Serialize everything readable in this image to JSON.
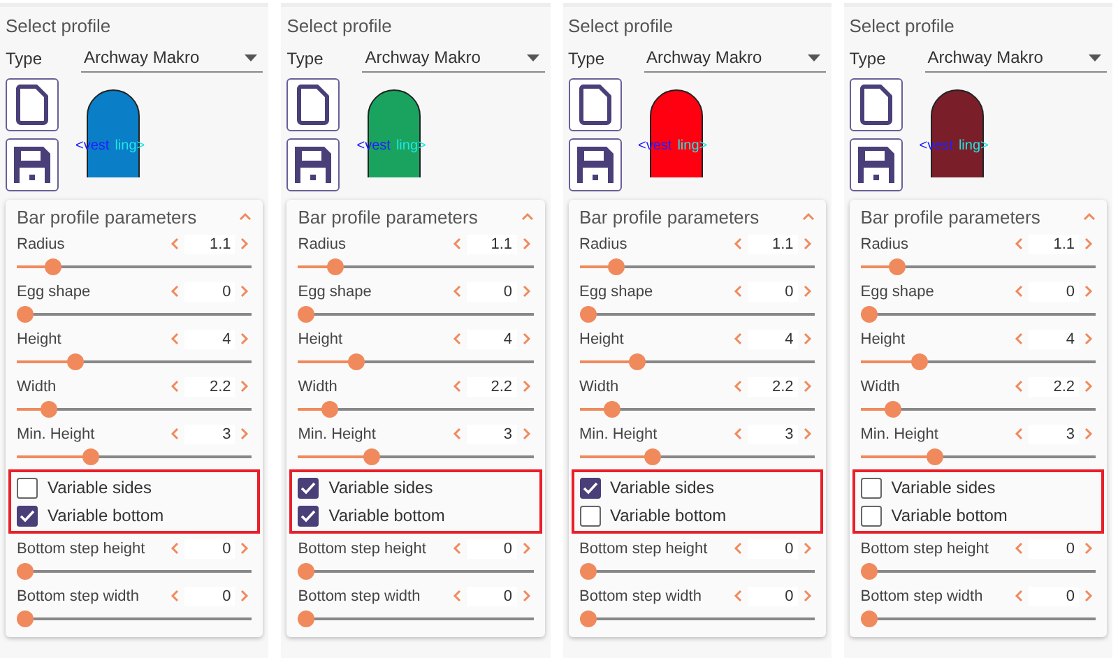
{
  "panels": [
    {
      "title": "Select profile",
      "type_label": "Type",
      "type_value": "Archway Makro",
      "color": "#0a7ec6",
      "preview_text": [
        "<vest",
        "ling>"
      ],
      "section": {
        "title": "Bar profile parameters",
        "expanded": true
      },
      "params": [
        {
          "label": "Radius",
          "value": "1.1",
          "level": 0.13
        },
        {
          "label": "Egg shape",
          "value": "0",
          "level": 0
        },
        {
          "label": "Height",
          "value": "4",
          "level": 0.23
        },
        {
          "label": "Width",
          "value": "2.2",
          "level": 0.11
        },
        {
          "label": "Min. Height",
          "value": "3",
          "level": 0.3
        }
      ],
      "checkboxes": [
        {
          "label": "Variable sides",
          "checked": false
        },
        {
          "label": "Variable bottom",
          "checked": true
        }
      ],
      "params_after": [
        {
          "label": "Bottom step height",
          "value": "0",
          "level": 0
        },
        {
          "label": "Bottom step width",
          "value": "0",
          "level": 0
        }
      ]
    },
    {
      "title": "Select profile",
      "type_label": "Type",
      "type_value": "Archway Makro",
      "color": "#1aa35f",
      "preview_text": [
        "<vest",
        "ling>"
      ],
      "section": {
        "title": "Bar profile parameters",
        "expanded": true
      },
      "params": [
        {
          "label": "Radius",
          "value": "1.1",
          "level": 0.13
        },
        {
          "label": "Egg shape",
          "value": "0",
          "level": 0
        },
        {
          "label": "Height",
          "value": "4",
          "level": 0.23
        },
        {
          "label": "Width",
          "value": "2.2",
          "level": 0.11
        },
        {
          "label": "Min. Height",
          "value": "3",
          "level": 0.3
        }
      ],
      "checkboxes": [
        {
          "label": "Variable sides",
          "checked": true
        },
        {
          "label": "Variable bottom",
          "checked": true
        }
      ],
      "params_after": [
        {
          "label": "Bottom step height",
          "value": "0",
          "level": 0
        },
        {
          "label": "Bottom step width",
          "value": "0",
          "level": 0
        }
      ]
    },
    {
      "title": "Select profile",
      "type_label": "Type",
      "type_value": "Archway Makro",
      "color": "#ff0010",
      "preview_text": [
        "<vest",
        "ling>"
      ],
      "section": {
        "title": "Bar profile parameters",
        "expanded": true
      },
      "params": [
        {
          "label": "Radius",
          "value": "1.1",
          "level": 0.13
        },
        {
          "label": "Egg shape",
          "value": "0",
          "level": 0
        },
        {
          "label": "Height",
          "value": "4",
          "level": 0.23
        },
        {
          "label": "Width",
          "value": "2.2",
          "level": 0.11
        },
        {
          "label": "Min. Height",
          "value": "3",
          "level": 0.3
        }
      ],
      "checkboxes": [
        {
          "label": "Variable sides",
          "checked": true
        },
        {
          "label": "Variable bottom",
          "checked": false
        }
      ],
      "params_after": [
        {
          "label": "Bottom step height",
          "value": "0",
          "level": 0
        },
        {
          "label": "Bottom step width",
          "value": "0",
          "level": 0
        }
      ]
    },
    {
      "title": "Select profile",
      "type_label": "Type",
      "type_value": "Archway Makro",
      "color": "#7a1f2a",
      "preview_text": [
        "<vest",
        "ling>"
      ],
      "section": {
        "title": "Bar profile parameters",
        "expanded": true
      },
      "params": [
        {
          "label": "Radius",
          "value": "1.1",
          "level": 0.13
        },
        {
          "label": "Egg shape",
          "value": "0",
          "level": 0
        },
        {
          "label": "Height",
          "value": "4",
          "level": 0.23
        },
        {
          "label": "Width",
          "value": "2.2",
          "level": 0.11
        },
        {
          "label": "Min. Height",
          "value": "3",
          "level": 0.3
        }
      ],
      "checkboxes": [
        {
          "label": "Variable sides",
          "checked": false
        },
        {
          "label": "Variable bottom",
          "checked": false
        }
      ],
      "params_after": [
        {
          "label": "Bottom step height",
          "value": "0",
          "level": 0
        },
        {
          "label": "Bottom step width",
          "value": "0",
          "level": 0
        }
      ]
    }
  ]
}
